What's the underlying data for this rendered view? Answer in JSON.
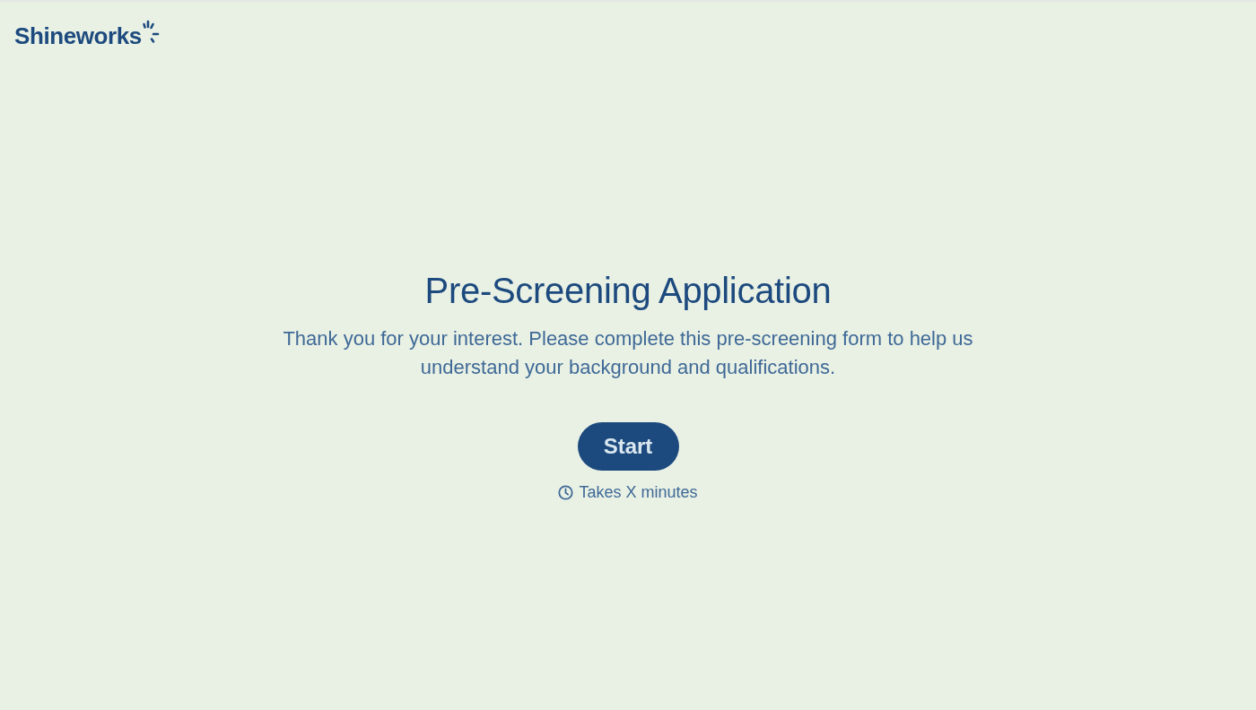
{
  "header": {
    "logo": {
      "name": "Shineworks"
    }
  },
  "intro": {
    "title": "Pre-Screening Application",
    "description": "Thank you for your interest. Please complete this pre-screening form to help us understand your background and qualifications.",
    "start_button": "Start",
    "duration": "Takes X minutes"
  }
}
